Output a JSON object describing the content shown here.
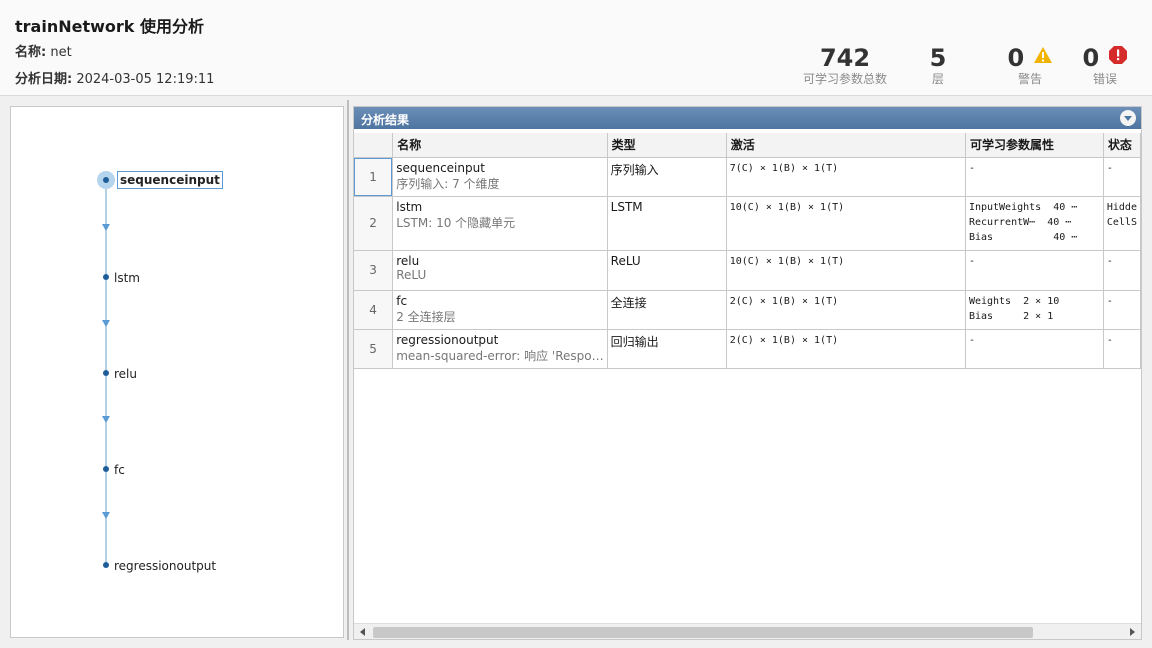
{
  "header": {
    "title": "trainNetwork 使用分析",
    "name_label": "名称:",
    "name_value": "net",
    "date_label": "分析日期:",
    "date_value": "2024-03-05 12:19:11"
  },
  "stats": [
    {
      "value": "742",
      "label": "可学习参数总数"
    },
    {
      "value": "5",
      "label": "层"
    },
    {
      "value": "0",
      "label": "警告",
      "icon": "warning-icon"
    },
    {
      "value": "0",
      "label": "错误",
      "icon": "error-icon"
    }
  ],
  "graph": {
    "nodes": [
      "sequenceinput",
      "lstm",
      "relu",
      "fc",
      "regressionoutput"
    ],
    "selected": "sequenceinput"
  },
  "results": {
    "title": "分析结果",
    "columns": [
      "名称",
      "类型",
      "激活",
      "可学习参数属性",
      "状态"
    ],
    "rows": [
      {
        "idx": "1",
        "name": "sequenceinput",
        "desc": "序列输入: 7 个维度",
        "type": "序列输入",
        "act": "7(C) × 1(B) × 1(T)",
        "params": [
          "-"
        ],
        "state": [
          "-"
        ]
      },
      {
        "idx": "2",
        "name": "lstm",
        "desc": "LSTM: 10 个隐藏单元",
        "type": "LSTM",
        "act": "10(C) × 1(B) × 1(T)",
        "params": [
          "InputWeights  40 ⋯",
          "RecurrentW⋯  40 ⋯",
          "Bias          40 ⋯"
        ],
        "state": [
          "Hidde",
          "CellS"
        ]
      },
      {
        "idx": "3",
        "name": "relu",
        "desc": "ReLU",
        "type": "ReLU",
        "act": "10(C) × 1(B) × 1(T)",
        "params": [
          "-"
        ],
        "state": [
          "-"
        ]
      },
      {
        "idx": "4",
        "name": "fc",
        "desc": "2 全连接层",
        "type": "全连接",
        "act": "2(C) × 1(B) × 1(T)",
        "params": [
          "Weights  2 × 10",
          "Bias     2 × 1"
        ],
        "state": [
          "-"
        ]
      },
      {
        "idx": "5",
        "name": "regressionoutput",
        "desc": "mean-squared-error: 响应 'Respo…",
        "type": "回归输出",
        "act": "2(C) × 1(B) × 1(T)",
        "params": [
          "-"
        ],
        "state": [
          "-"
        ]
      }
    ]
  },
  "colors": {
    "accent": "#5b9bd5",
    "header_bar": "#4e74a0",
    "warning": "#f0b400",
    "error": "#d62b2b"
  }
}
